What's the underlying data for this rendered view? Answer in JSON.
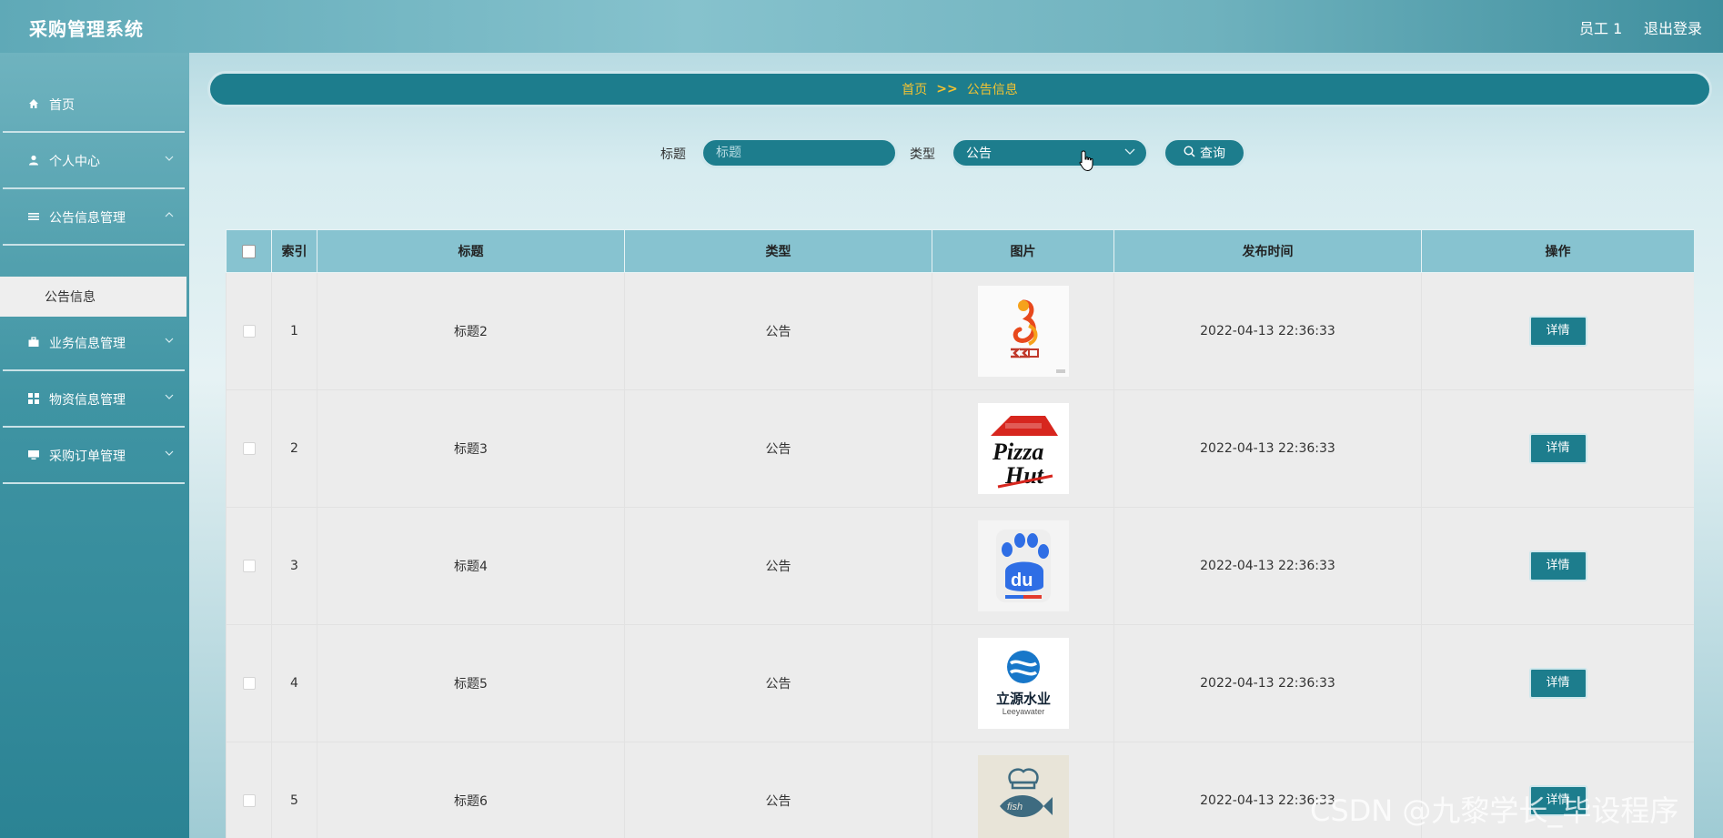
{
  "header": {
    "title": "采购管理系统",
    "user": "员工 1",
    "logout": "退出登录"
  },
  "sidebar": {
    "items": [
      {
        "label": "首页",
        "icon": "home-icon"
      },
      {
        "label": "个人中心",
        "icon": "user-icon"
      },
      {
        "label": "公告信息管理",
        "icon": "list-icon"
      },
      {
        "label": "业务信息管理",
        "icon": "briefcase-icon"
      },
      {
        "label": "物资信息管理",
        "icon": "grid-icon"
      },
      {
        "label": "采购订单管理",
        "icon": "monitor-icon"
      }
    ],
    "submenu": {
      "label": "公告信息"
    }
  },
  "breadcrumb": {
    "home": "首页",
    "separator": ">>",
    "current": "公告信息"
  },
  "search": {
    "title_label": "标题",
    "title_placeholder": "标题",
    "type_label": "类型",
    "type_value": "公告",
    "query_button": "查询"
  },
  "table": {
    "columns": [
      "索引",
      "标题",
      "类型",
      "图片",
      "发布时间",
      "操作"
    ],
    "rows": [
      {
        "index": "1",
        "title": "标题2",
        "type": "公告",
        "image": "33-logo",
        "time": "2022-04-13 22:36:33",
        "action": "详情"
      },
      {
        "index": "2",
        "title": "标题3",
        "type": "公告",
        "image": "pizza-hut-logo",
        "time": "2022-04-13 22:36:33",
        "action": "详情"
      },
      {
        "index": "3",
        "title": "标题4",
        "type": "公告",
        "image": "baidu-logo",
        "time": "2022-04-13 22:36:33",
        "action": "详情"
      },
      {
        "index": "4",
        "title": "标题5",
        "type": "公告",
        "image": "liyuan-water-logo",
        "time": "2022-04-13 22:36:33",
        "action": "详情"
      },
      {
        "index": "5",
        "title": "标题6",
        "type": "公告",
        "image": "fish-chef-logo",
        "time": "2022-04-13 22:36:33",
        "action": "详情"
      }
    ]
  },
  "logos": {
    "pizza_word_1": "Pizza",
    "pizza_word_2": "Hut",
    "baidu_text": "du",
    "water_cn": "立源水业",
    "water_en": "Leeyawater",
    "fish_text": "fish"
  },
  "watermark": "CSDN @九黎学长_毕设程序",
  "colors": {
    "primary": "#1d7d8d",
    "table_header": "#87c3d0",
    "breadcrumb_text": "#f1c232",
    "row_bg": "#ececec"
  }
}
